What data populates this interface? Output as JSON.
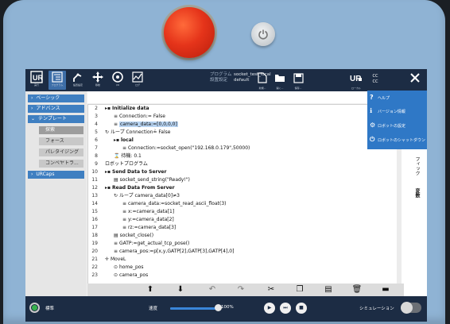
{
  "topbar": {
    "left_buttons": [
      {
        "id": "run",
        "label": "実行"
      },
      {
        "id": "program",
        "label": "プログラム"
      },
      {
        "id": "install",
        "label": "設置設定"
      },
      {
        "id": "move",
        "label": "移動"
      },
      {
        "id": "io",
        "label": "I/O"
      },
      {
        "id": "log",
        "label": "ログ"
      }
    ],
    "program_key": "プログラム",
    "program_value": "socket_test_local",
    "install_key": "設置設定",
    "install_value": "default",
    "file_buttons": [
      {
        "id": "new",
        "label": "新規..."
      },
      {
        "id": "open",
        "label": "開く..."
      },
      {
        "id": "save",
        "label": "保存..."
      }
    ],
    "right_buttons": [
      {
        "id": "local",
        "label": "ローカル"
      },
      {
        "id": "cc",
        "label": "CC CC"
      },
      {
        "id": "menu",
        "label": ""
      }
    ]
  },
  "sidebar": {
    "items": [
      {
        "label": "ベーシック"
      },
      {
        "label": "アドバンス"
      },
      {
        "label": "テンプレート"
      }
    ],
    "template_subitems": [
      "探索",
      "フォース",
      "パレタイジング",
      "コンベヤトラ..."
    ],
    "urcaps": "URCaps"
  },
  "program_lines": [
    {
      "n": "2",
      "text": "Initialize data",
      "bold": true,
      "indent": 0,
      "icon": "folder"
    },
    {
      "n": "3",
      "text": "Connection:= False",
      "indent": 1,
      "icon": "assign"
    },
    {
      "n": "4",
      "text": "camera_data:=[0,0,0,0]",
      "indent": 1,
      "icon": "assign",
      "selected": true
    },
    {
      "n": "5",
      "text": "ループ Connection≟ False",
      "indent": 0,
      "icon": "loop"
    },
    {
      "n": "6",
      "text": "local",
      "bold": true,
      "indent": 1,
      "icon": "folder"
    },
    {
      "n": "7",
      "text": "Connection:=socket_open(\"192.168.0.179\",50000)",
      "indent": 2,
      "icon": "assign"
    },
    {
      "n": "8",
      "text": "待機: 0.1",
      "indent": 1,
      "icon": "wait"
    },
    {
      "n": "9",
      "text": "ロボットプログラム",
      "bold": false,
      "indent": 0,
      "icon": "none"
    },
    {
      "n": "10",
      "text": "Send Data to Server",
      "bold": true,
      "indent": 0,
      "icon": "folder"
    },
    {
      "n": "11",
      "text": "socket_send_string(\"Ready!\")",
      "indent": 1,
      "icon": "script"
    },
    {
      "n": "12",
      "text": "Read Data From Server",
      "bold": true,
      "indent": 0,
      "icon": "folder"
    },
    {
      "n": "13",
      "text": "ループ camera_data[0]≠3",
      "indent": 1,
      "icon": "loop"
    },
    {
      "n": "14",
      "text": "camera_data:=socket_read_ascii_float(3)",
      "indent": 2,
      "icon": "assign"
    },
    {
      "n": "15",
      "text": "x:=camera_data[1]",
      "indent": 2,
      "icon": "assign"
    },
    {
      "n": "16",
      "text": "y:=camera_data[2]",
      "indent": 2,
      "icon": "assign"
    },
    {
      "n": "17",
      "text": "rz:=camera_data[3]",
      "indent": 2,
      "icon": "assign"
    },
    {
      "n": "18",
      "text": "socket_close()",
      "indent": 1,
      "icon": "script"
    },
    {
      "n": "19",
      "text": "GATP:=get_actual_tcp_pose()",
      "indent": 1,
      "icon": "assign"
    },
    {
      "n": "20",
      "text": "camera_pos:=p[x,y,GATP[2],GATP[3],GATP[4],0]",
      "indent": 1,
      "icon": "assign"
    },
    {
      "n": "21",
      "text": "MoveL",
      "indent": 0,
      "icon": "move"
    },
    {
      "n": "22",
      "text": "home_pos",
      "indent": 1,
      "icon": "waypoint"
    },
    {
      "n": "23",
      "text": "camera_pos",
      "indent": 1,
      "icon": "waypoint"
    }
  ],
  "menu": {
    "items": [
      "ヘルプ",
      "バージョン情報",
      "ロボットの設定",
      "ロボットのシャットダウン"
    ]
  },
  "rightpanel": {
    "text1": "フィック",
    "text2": "変数"
  },
  "status": {
    "mode_label": "標準",
    "speed_label": "速度",
    "speed_value": "100%",
    "speed_fraction": 1.0,
    "sim_label": "シミュレーション"
  },
  "colors": {
    "accent": "#3f7fc1",
    "topbar": "#1c2c44",
    "estop": "#e5341a",
    "running": "#37b24d"
  }
}
